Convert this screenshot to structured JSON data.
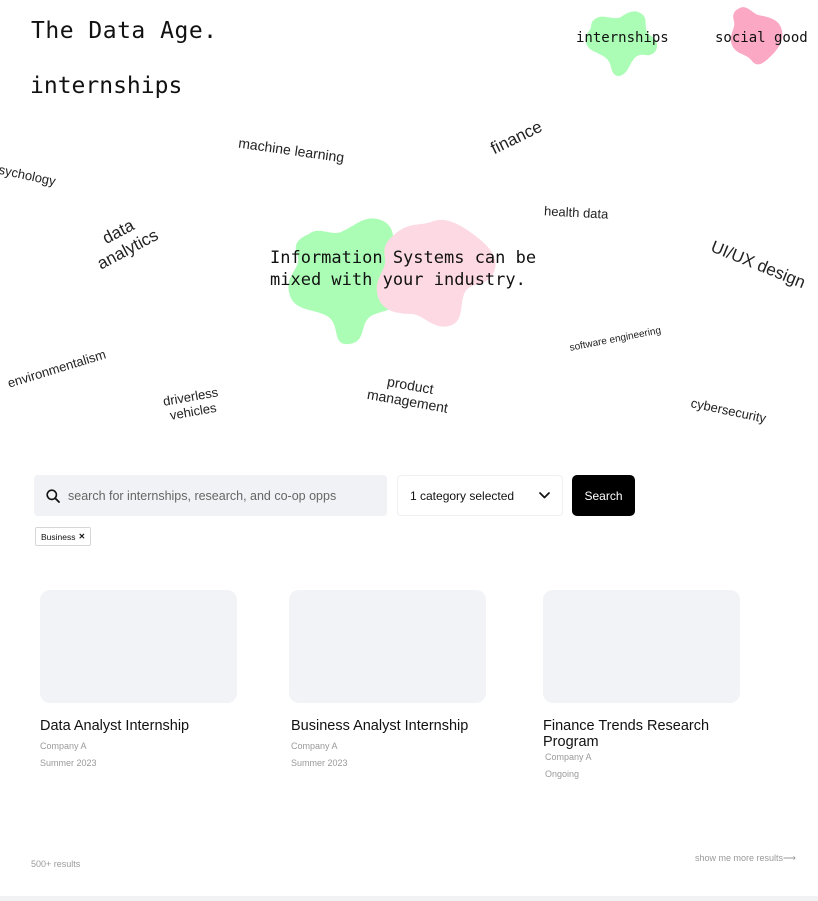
{
  "brand": {
    "logo": "The Data Age."
  },
  "page": {
    "title": "internships"
  },
  "nav": {
    "items": [
      {
        "label": "internships",
        "blob_color": "#abfdb5"
      },
      {
        "label": "social good",
        "blob_color": "#fba8c4"
      }
    ]
  },
  "topics": [
    "psychology",
    "machine learning",
    "finance",
    "health data",
    "data analytics",
    "UI/UX design",
    "environmentalism",
    "software engineering",
    "driverless vehicles",
    "product management",
    "cybersecurity"
  ],
  "hero": {
    "line1": "Information Systems can be",
    "line2": "mixed with your industry.",
    "green": "#abfdb5",
    "pink": "#fcd9e3"
  },
  "search": {
    "icon": "search-icon",
    "placeholder": "search for internships, research, and co-op opps",
    "category_label": "1 category selected",
    "button_label": "Search"
  },
  "filters": {
    "chips": [
      {
        "label": "Business",
        "remove": "✕"
      }
    ]
  },
  "opportunities": [
    {
      "title": "Data Analyst Internship",
      "company": "Company A",
      "term": "Summer 2023"
    },
    {
      "title": "Business Analyst Internship",
      "company": "Company A",
      "term": "Summer 2023"
    },
    {
      "title": "Finance Trends Research Program",
      "company": "Company A",
      "term": "Ongoing"
    }
  ],
  "footer": {
    "results_count": "500+ results",
    "more_link": "show me more results⟶"
  }
}
